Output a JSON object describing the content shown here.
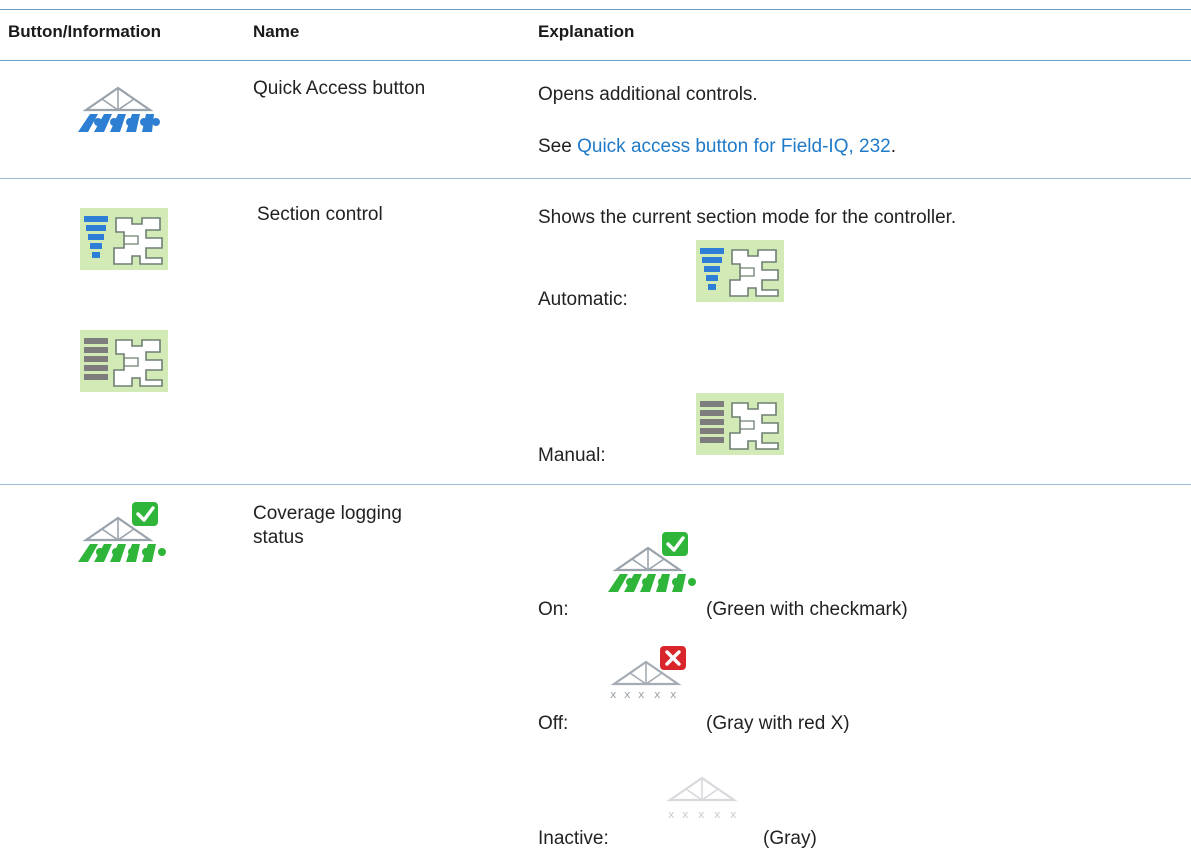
{
  "header": {
    "col_button": "Button/Information",
    "col_name": "Name",
    "col_explanation": "Explanation"
  },
  "rows": [
    {
      "icon": "sprayer-blue-icon",
      "name": "Quick Access button",
      "explanation": "Opens additional controls.",
      "see_prefix": "See ",
      "see_link": "Quick access button for Field-IQ, 232",
      "see_suffix": "."
    },
    {
      "icon": "section-control-icon",
      "name": "Section control",
      "explanation": "Shows the current section mode for the controller.",
      "modes": [
        {
          "label": "Automatic:",
          "icon": "section-control-automatic-icon"
        },
        {
          "label": "Manual:",
          "icon": "section-control-manual-icon"
        }
      ]
    },
    {
      "icon": "coverage-logging-on-icon",
      "name_line1": "Coverage logging",
      "name_line2": "status",
      "states": [
        {
          "label": "On:",
          "desc": "(Green with checkmark)",
          "icon": "coverage-logging-on-icon"
        },
        {
          "label": "Off:",
          "desc": "(Gray with red X)",
          "icon": "coverage-logging-off-icon"
        },
        {
          "label": "Inactive:",
          "desc": "(Gray)",
          "icon": "coverage-logging-inactive-icon"
        }
      ]
    }
  ],
  "colors": {
    "rule": "#6f9fc8",
    "link": "#1f7ac8",
    "section_bg": "#d2ebb6",
    "coverage_green": "#2fb53a",
    "off_red": "#d9262c"
  }
}
